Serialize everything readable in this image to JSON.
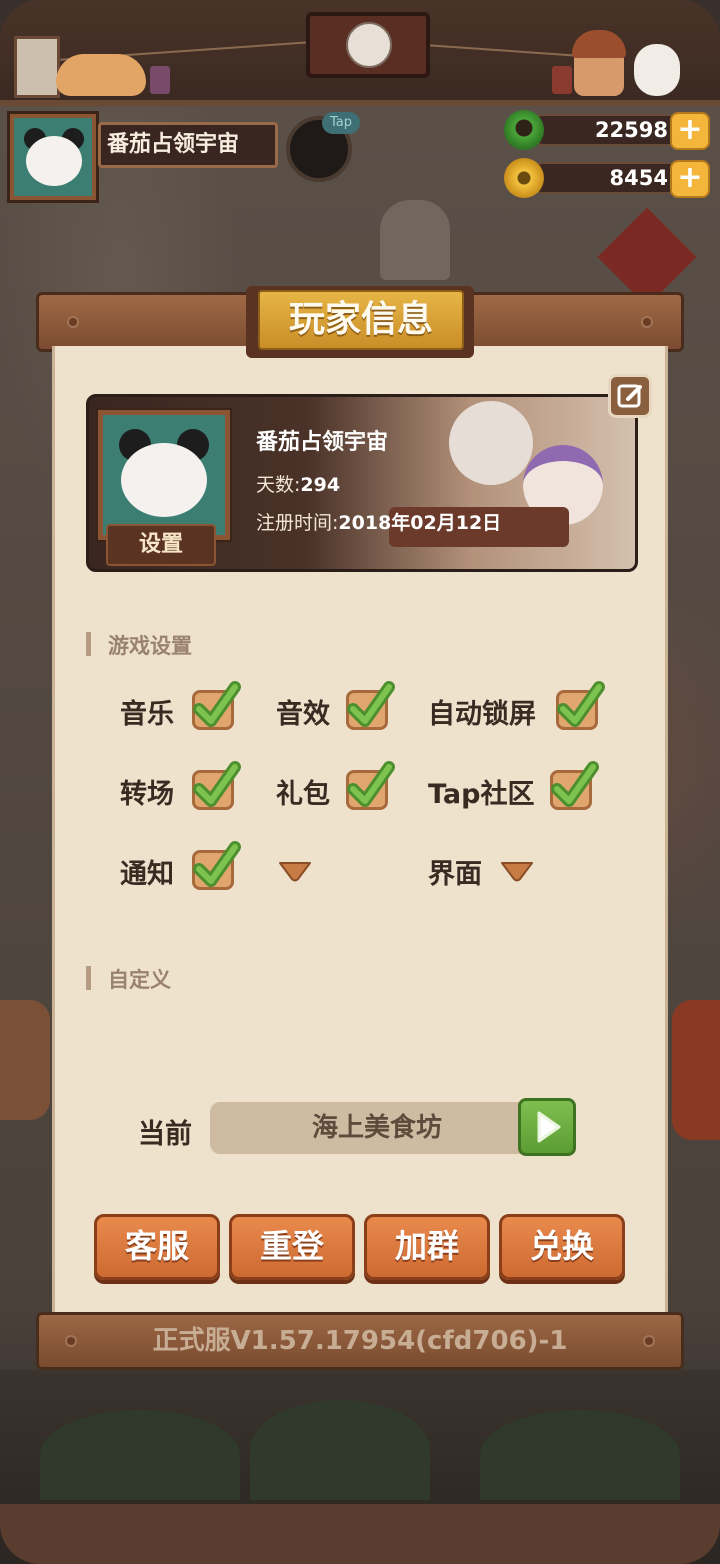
{
  "header": {
    "player_name": "番茄占领宇宙",
    "tap_badge": "Tap",
    "jade_amount": "22598",
    "coin_amount": "8454",
    "plus_symbol": "+"
  },
  "panel": {
    "title": "玩家信息",
    "profile": {
      "name": "番茄占领宇宙",
      "days_label": "天数:",
      "days_value": "294",
      "register_label": "注册时间:",
      "register_value": "2018年02月12日",
      "settings_label": "设置"
    },
    "game_settings": {
      "heading": "游戏设置",
      "options": [
        {
          "label": "音乐",
          "checked": true
        },
        {
          "label": "音效",
          "checked": true
        },
        {
          "label": "自动锁屏",
          "checked": true
        },
        {
          "label": "转场",
          "checked": true
        },
        {
          "label": "礼包",
          "checked": true
        },
        {
          "label": "Tap社区",
          "checked": true
        },
        {
          "label": "通知",
          "checked": true
        },
        {
          "label": "",
          "checked": false
        },
        {
          "label": "界面",
          "checked": false
        }
      ]
    },
    "custom": {
      "heading": "自定义",
      "current_label": "当前",
      "current_value": "海上美食坊"
    },
    "buttons": {
      "service": "客服",
      "relogin": "重登",
      "join_group": "加群",
      "redeem": "兑换"
    },
    "version": "正式服V1.57.17954(cfd706)-1"
  },
  "colors": {
    "panel_bg": "#eee2cd",
    "title_gold": "#e7b546",
    "button_orange": "#e98a4d",
    "check_green": "#6fb04a"
  }
}
